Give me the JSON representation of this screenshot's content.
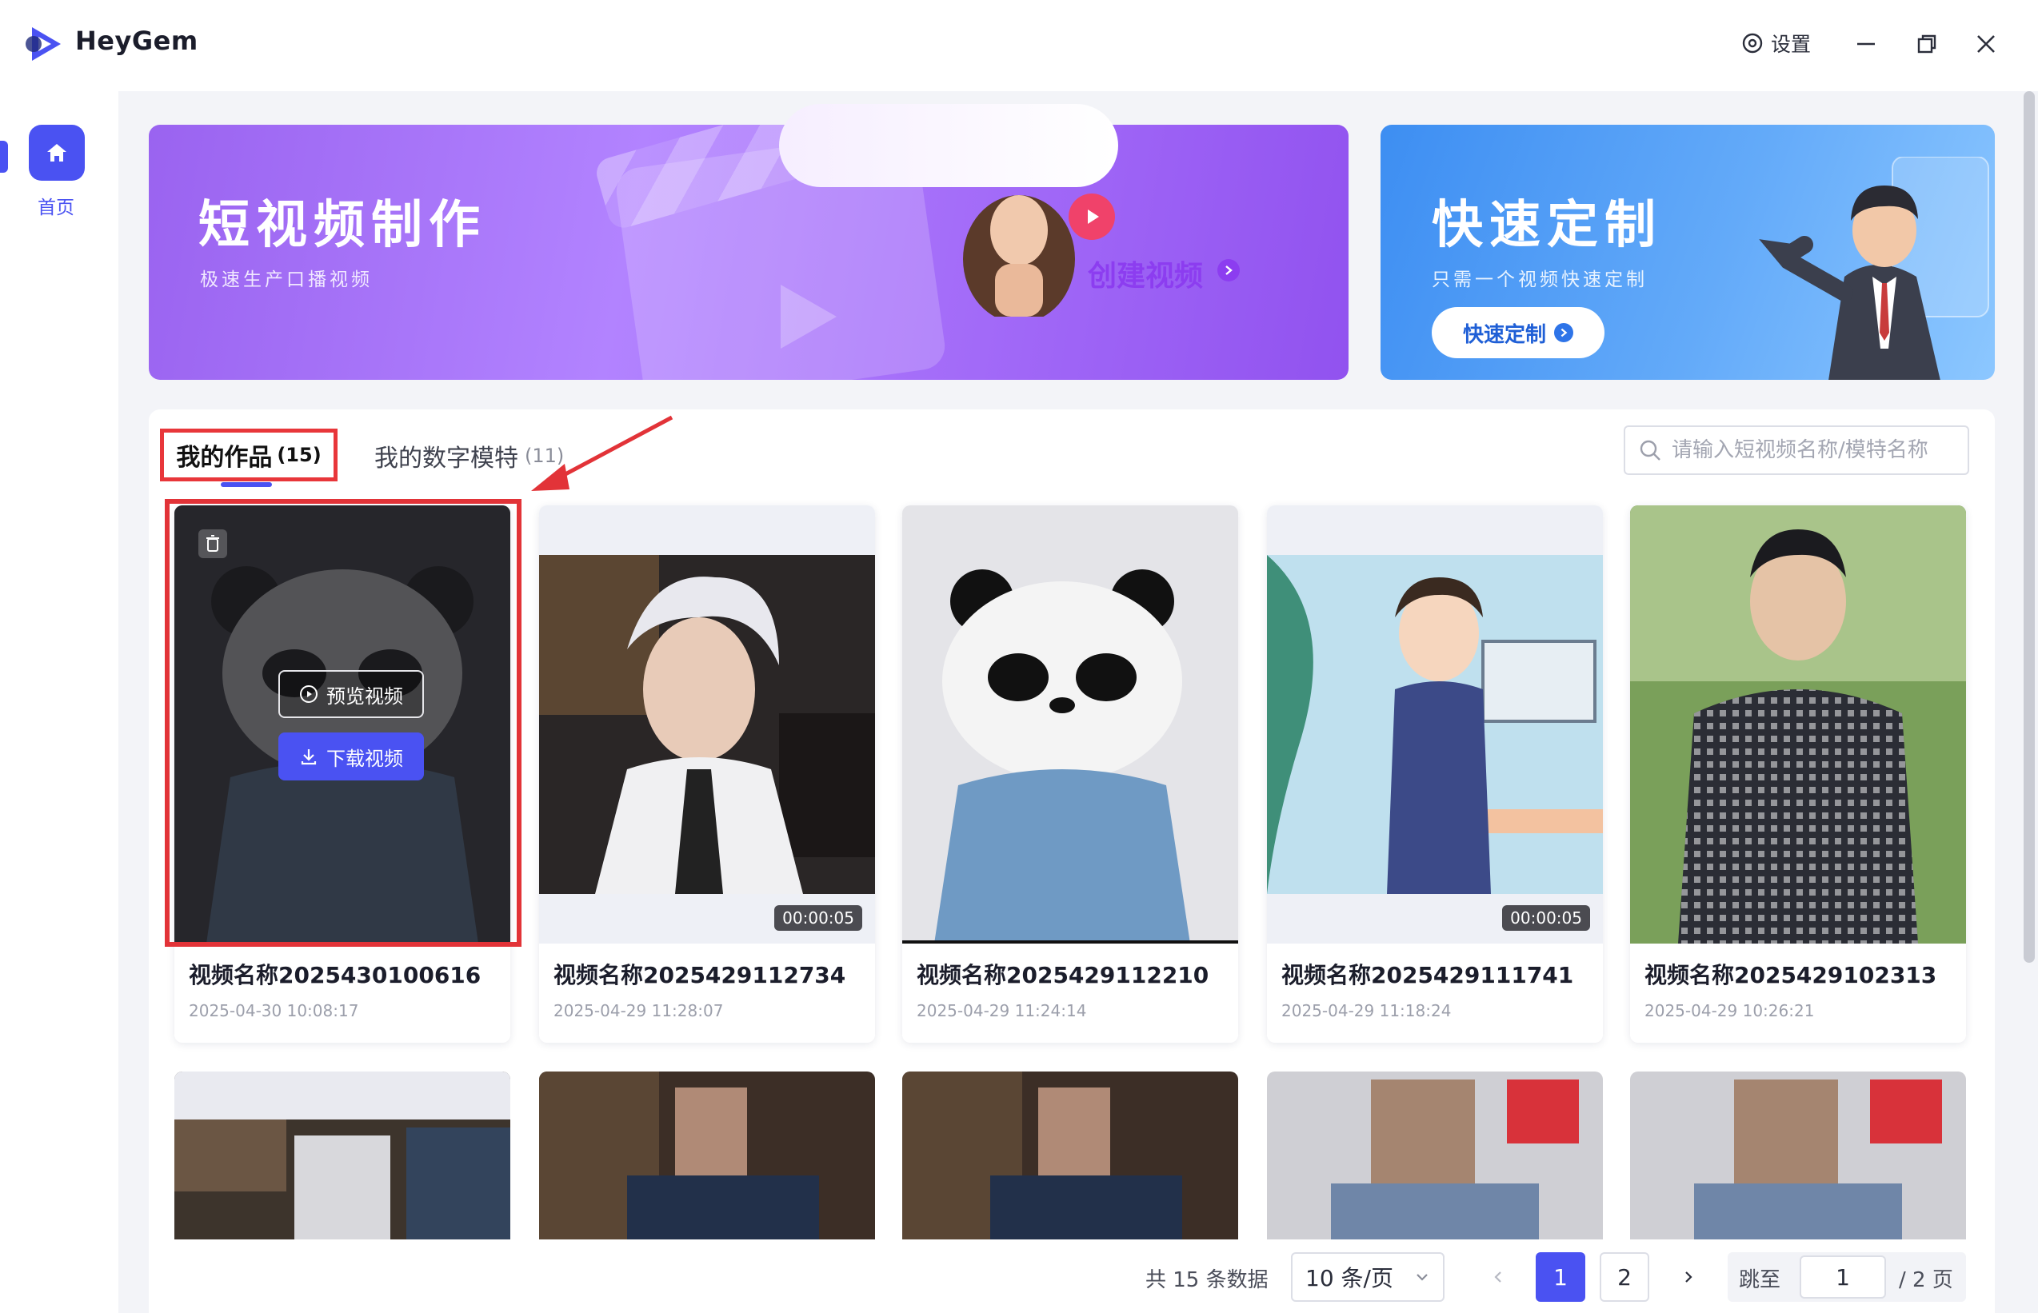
{
  "app": {
    "name": "HeyGem"
  },
  "window": {
    "settings_label": "设置"
  },
  "sidebar": {
    "home_label": "首页"
  },
  "banners": {
    "short_video": {
      "title": "短视频制作",
      "subtitle": "极速生产口播视频",
      "button": "创建视频"
    },
    "quick_custom": {
      "title": "快速定制",
      "subtitle": "只需一个视频快速定制",
      "button": "快速定制"
    }
  },
  "tabs": [
    {
      "label": "我的作品",
      "count": "(15)",
      "active": true
    },
    {
      "label": "我的数字模特",
      "count": "(11)",
      "active": false
    }
  ],
  "search": {
    "placeholder": "请输入短视频名称/模特名称"
  },
  "cards": [
    {
      "title": "视频名称2025430100616",
      "date": "2025-04-30 10:08:17",
      "duration": "",
      "thumb": "panda-dark",
      "hover": true
    },
    {
      "title": "视频名称2025429112734",
      "date": "2025-04-29 11:28:07",
      "duration": "00:00:05",
      "thumb": "man-white-hair"
    },
    {
      "title": "视频名称2025429112210",
      "date": "2025-04-29 11:24:14",
      "duration": "",
      "thumb": "panda"
    },
    {
      "title": "视频名称2025429111741",
      "date": "2025-04-29 11:18:24",
      "duration": "00:00:05",
      "thumb": "cartoon-office"
    },
    {
      "title": "视频名称2025429102313",
      "date": "2025-04-29 10:26:21",
      "duration": "",
      "thumb": "man-outdoor"
    }
  ],
  "hover_actions": {
    "preview": "预览视频",
    "download": "下载视频"
  },
  "pagination": {
    "total": "共 15 条数据",
    "page_size": "10 条/页",
    "pages": [
      "1",
      "2"
    ],
    "current": "1",
    "jump_label": "跳至",
    "jump_value": "1",
    "total_pages": "/ 2 页"
  },
  "colors": {
    "accent": "#4a52f2",
    "highlight": "#e23338"
  }
}
